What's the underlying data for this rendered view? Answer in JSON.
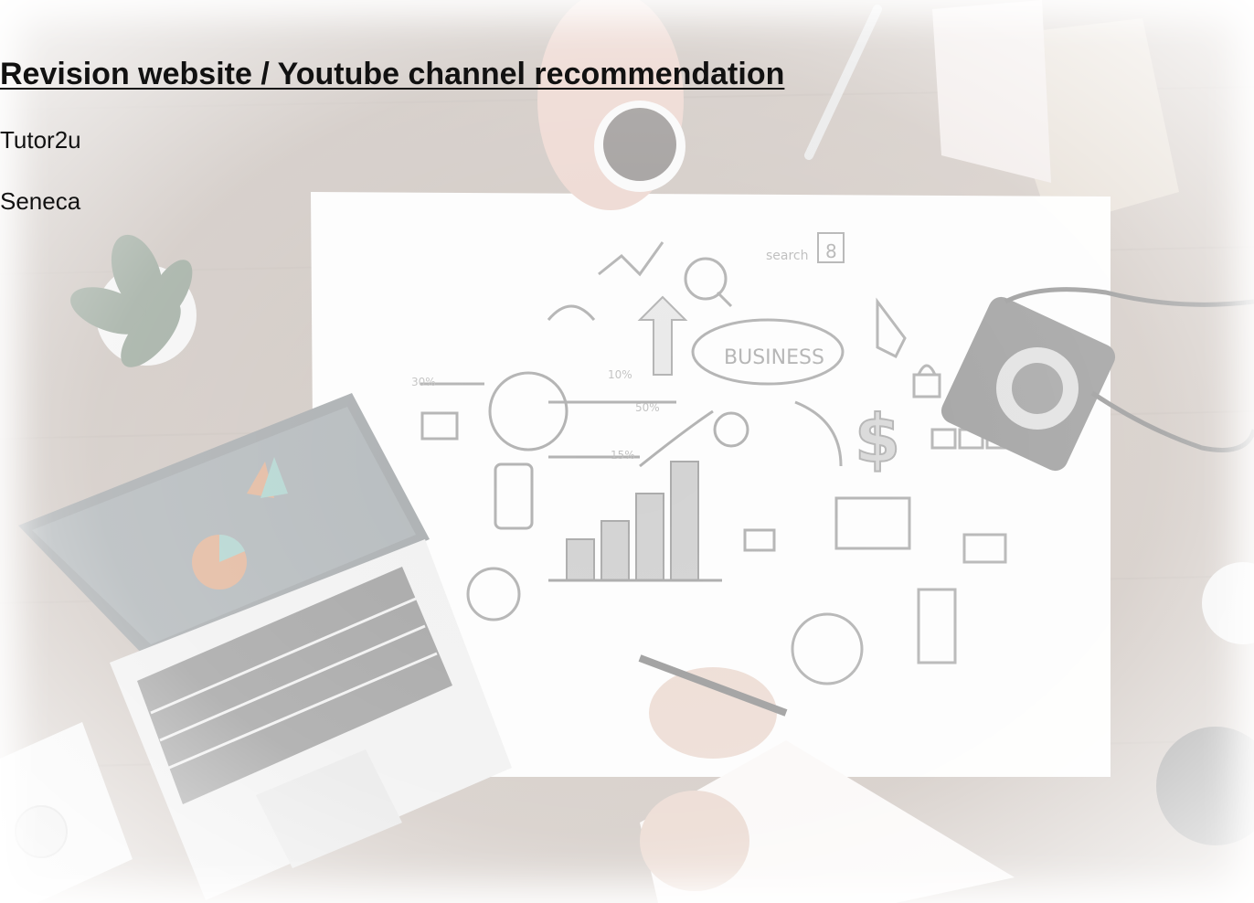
{
  "heading": "Revision website / Youtube channel recommendation",
  "recommendations": [
    "Tutor2u",
    "Seneca"
  ],
  "background_image": {
    "paper_text": [
      "BUSINESS",
      "search",
      "8",
      "30%",
      "10%",
      "50%",
      "15%"
    ]
  },
  "colors": {
    "text": "#111111",
    "wood": "#a8968a",
    "paper": "#fbfbfa",
    "laptop_screen": "#4f5a60"
  }
}
